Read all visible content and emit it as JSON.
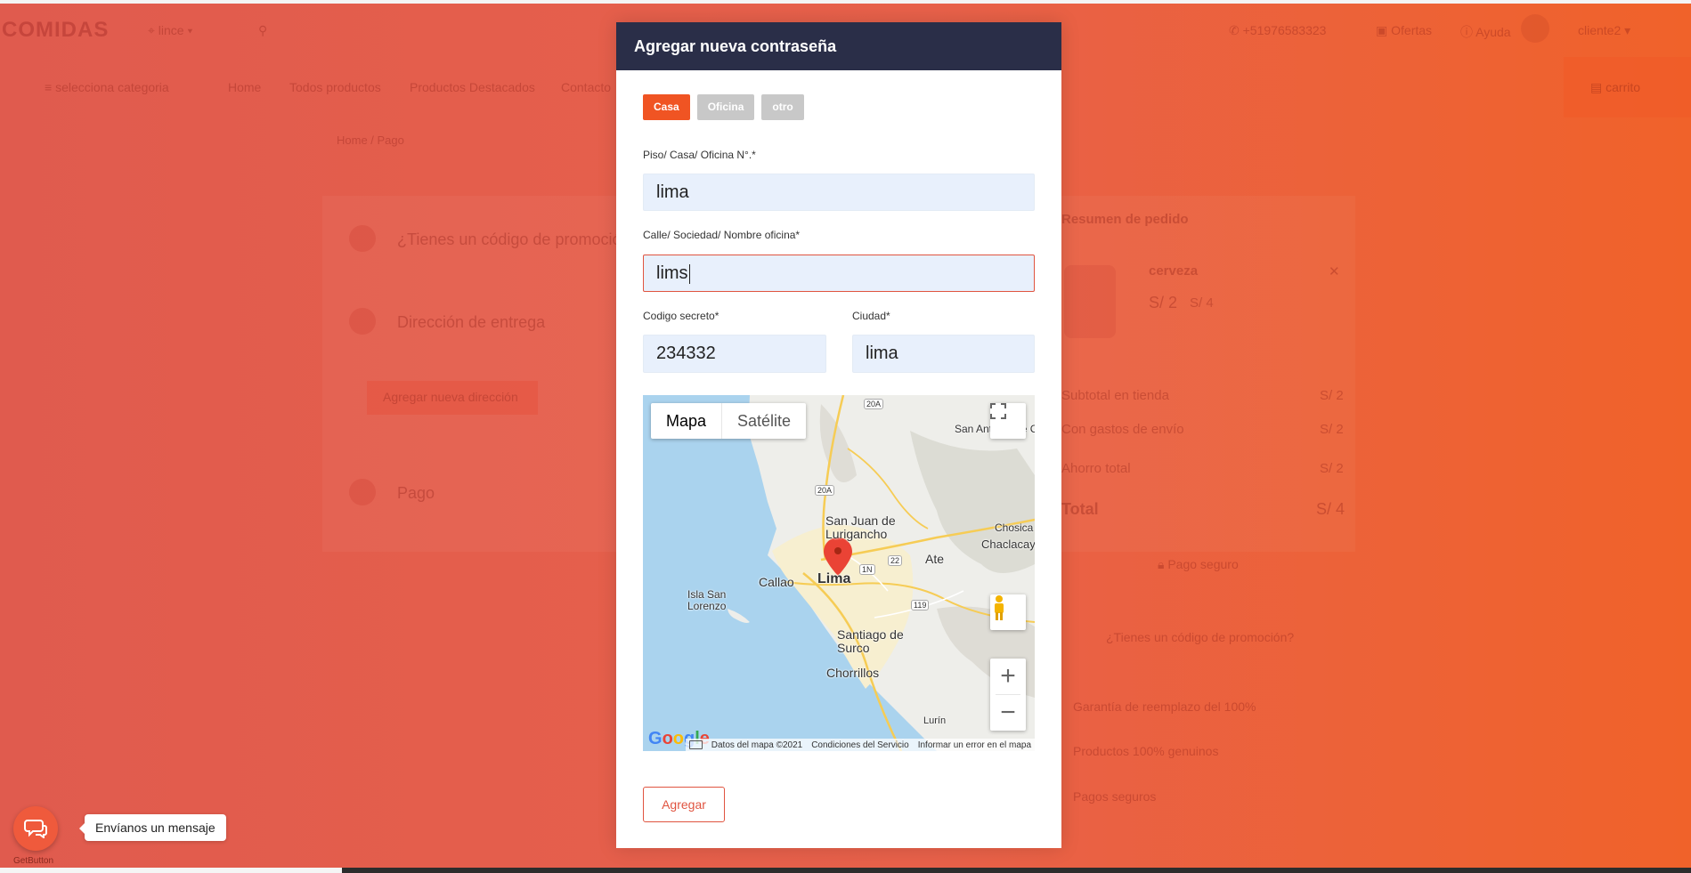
{
  "background": {
    "logo": "COMIDAS",
    "location": "lince",
    "search_placeholder": "",
    "phone": "+51976583323",
    "offers": "Ofertas",
    "help": "Ayuda",
    "user": "cliente2",
    "category_menu": "selecciona categoria",
    "nav": [
      "Home",
      "Todos productos",
      "Productos Destacados",
      "Contacto"
    ],
    "cart": "carrito",
    "breadcrumb": "Home  /  Pago",
    "steps": [
      "¿Tienes un código de promoción?",
      "Dirección de entrega",
      "Pago"
    ],
    "add_address_button": "Agregar nueva dirección",
    "summary": {
      "title": "Resumen de pedido",
      "product": "cerveza",
      "price": "S/ 2",
      "old_price": "S/ 4",
      "rows": [
        {
          "label": "Subtotal en tienda",
          "value": "S/ 2"
        },
        {
          "label": "Con gastos de envío",
          "value": "S/ 2"
        },
        {
          "label": "Ahorro total",
          "value": "S/ 2"
        }
      ],
      "total_label": "Total",
      "total_value": "S/ 4",
      "secure": "Pago seguro",
      "promo": "¿Tienes un código de promoción?",
      "features": [
        "Garantía de reemplazo del 100%",
        "Productos 100% genuinos",
        "Pagos seguros"
      ]
    }
  },
  "modal": {
    "title": "Agregar nueva contraseña",
    "types": [
      "Casa",
      "Oficina",
      "otro"
    ],
    "active_type": "Casa",
    "fields": {
      "floor": {
        "label": "Piso/ Casa/ Oficina N°.*",
        "value": "lima"
      },
      "street": {
        "label": "Calle/ Sociedad/ Nombre oficina*",
        "value": "lims"
      },
      "secret": {
        "label": "Codigo secreto*",
        "value": "234332"
      },
      "city": {
        "label": "Ciudad*",
        "value": "lima"
      }
    },
    "submit_label": "Agregar"
  },
  "map": {
    "type_map": "Mapa",
    "type_satellite": "Satélite",
    "zoom_in": "+",
    "zoom_out": "−",
    "places": {
      "san_antonio": "San Antonio de Chaclla",
      "sjl": "San Juan de Lurigancho",
      "chosica": "Chosica",
      "chaclacayo": "Chaclacayo",
      "ate": "Ate",
      "callao": "Callao",
      "lima": "Lima",
      "isla": "Isla San Lorenzo",
      "surco": "Santiago de Surco",
      "chorrillos": "Chorrillos",
      "lurin": "Lurín"
    },
    "routes": [
      "20A",
      "20A",
      "1N",
      "22",
      "119"
    ],
    "google_logo": "Google",
    "attribution": {
      "data": "Datos del mapa ©2021",
      "terms": "Condiciones del Servicio",
      "report": "Informar un error en el mapa"
    }
  },
  "chat": {
    "bubble": "Envíanos un mensaje",
    "brand": "GetButton"
  },
  "colors": {
    "accent": "#f05423",
    "header": "#2a2e48",
    "field_bg": "#e8f0fc",
    "overlay_start": "#e05b4e",
    "overlay_end": "#f0622a"
  }
}
